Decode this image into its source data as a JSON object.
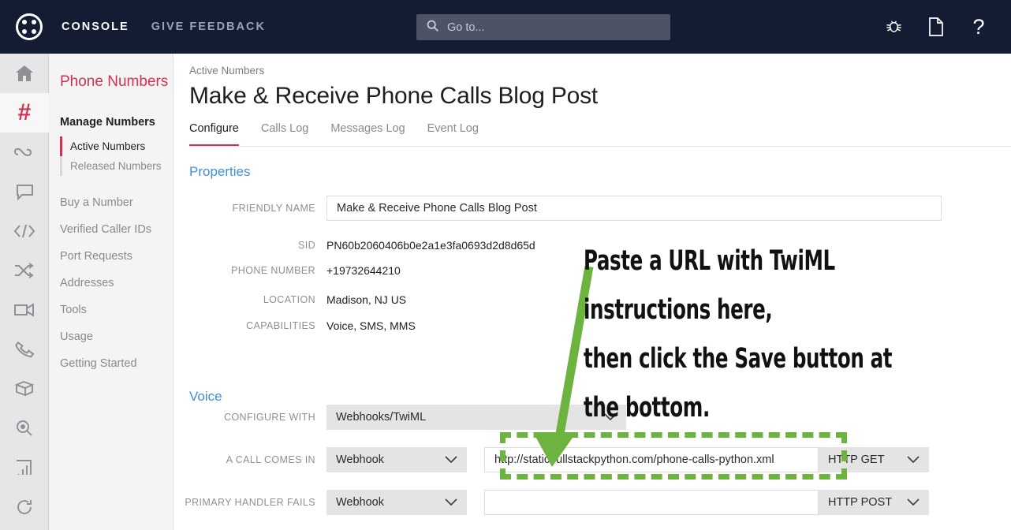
{
  "topbar": {
    "logo_icon": "twilio-logo-icon",
    "console_label": "CONSOLE",
    "feedback_label": "GIVE FEEDBACK",
    "search_placeholder": "Go to...",
    "search_icon": "search-icon",
    "icons": [
      {
        "name": "bug-icon",
        "glyph": "bug"
      },
      {
        "name": "document-icon",
        "glyph": "document"
      },
      {
        "name": "help-icon",
        "glyph": "?"
      }
    ],
    "bg_color": "#131c33"
  },
  "rail": {
    "items": [
      {
        "name": "home-icon",
        "selected": false
      },
      {
        "name": "phone-numbers-hash-icon",
        "label": "#",
        "selected": true
      },
      {
        "name": "superlink-icon",
        "selected": false
      },
      {
        "name": "chat-bubble-icon",
        "selected": false
      },
      {
        "name": "code-icon",
        "selected": false
      },
      {
        "name": "shuffle-icon",
        "selected": false
      },
      {
        "name": "video-camera-icon",
        "selected": false
      },
      {
        "name": "phone-handset-icon",
        "selected": false
      },
      {
        "name": "cube-icon",
        "selected": false
      },
      {
        "name": "search-magnifier-icon",
        "selected": false
      },
      {
        "name": "bar-chart-icon",
        "selected": false
      },
      {
        "name": "sync-icon",
        "selected": false
      }
    ],
    "accent_color": "#d4304f"
  },
  "sidebar": {
    "title": "Phone Numbers",
    "group_label": "Manage Numbers",
    "sub_items": [
      {
        "label": "Active Numbers",
        "active": true
      },
      {
        "label": "Released Numbers",
        "active": false
      }
    ],
    "links": [
      "Buy a Number",
      "Verified Caller IDs",
      "Port Requests",
      "Addresses",
      "Tools",
      "Usage",
      "Getting Started"
    ]
  },
  "main": {
    "breadcrumb": "Active Numbers",
    "page_title": "Make & Receive Phone Calls Blog Post",
    "tabs": [
      {
        "label": "Configure",
        "active": true
      },
      {
        "label": "Calls Log",
        "active": false
      },
      {
        "label": "Messages Log",
        "active": false
      },
      {
        "label": "Event Log",
        "active": false
      }
    ],
    "properties": {
      "heading": "Properties",
      "friendly_name_label": "FRIENDLY NAME",
      "friendly_name_value": "Make & Receive Phone Calls Blog Post",
      "sid_label": "SID",
      "sid_value": "PN60b2060406b0e2a1e3fa0693d2d8d65d",
      "phone_label": "PHONE NUMBER",
      "phone_value": "+19732644210",
      "location_label": "LOCATION",
      "location_value": "Madison, NJ US",
      "capabilities_label": "CAPABILITIES",
      "capabilities_value": "Voice, SMS, MMS"
    },
    "voice": {
      "heading": "Voice",
      "configure_with_label": "CONFIGURE WITH",
      "configure_with_value": "Webhooks/TwiML",
      "call_comes_in_label": "A CALL COMES IN",
      "call_comes_in_type": "Webhook",
      "call_comes_in_url": "http://static.fullstackpython.com/phone-calls-python.xml",
      "call_comes_in_method": "HTTP GET",
      "primary_handler_fails_label": "PRIMARY HANDLER FAILS",
      "primary_handler_fails_type": "Webhook",
      "primary_handler_fails_url": "",
      "primary_handler_fails_method": "HTTP POST"
    },
    "heading_color": "#3f8fd8"
  },
  "annotation": {
    "line1": "Paste a URL with TwiML instructions here,",
    "line2": "then click the Save button at the bottom.",
    "color": "#111111",
    "highlight_color": "#6cb33f"
  }
}
